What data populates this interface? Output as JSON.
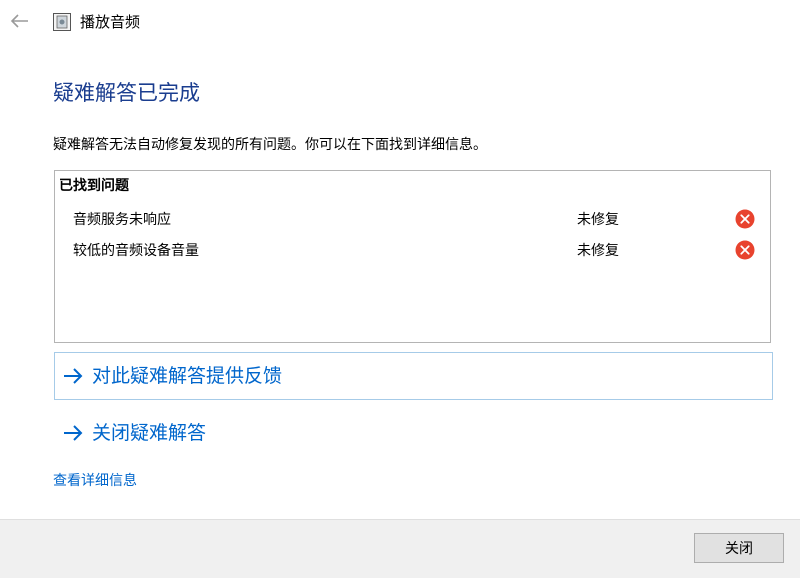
{
  "window": {
    "title": "播放音频"
  },
  "main": {
    "heading": "疑难解答已完成",
    "description": "疑难解答无法自动修复发现的所有问题。你可以在下面找到详细信息。"
  },
  "problems": {
    "header": "已找到问题",
    "items": [
      {
        "name": "音频服务未响应",
        "status": "未修复",
        "icon": "error-x-icon"
      },
      {
        "name": "较低的音频设备音量",
        "status": "未修复",
        "icon": "error-x-icon"
      }
    ]
  },
  "actions": {
    "feedback_label": "对此疑难解答提供反馈",
    "close_troubleshooter_label": "关闭疑难解答",
    "details_link": "查看详细信息"
  },
  "footer": {
    "close_label": "关闭"
  },
  "colors": {
    "heading": "#1a3d8f",
    "link": "#0066cc",
    "error": "#e81123",
    "footer_bg": "#f0f0f0"
  }
}
